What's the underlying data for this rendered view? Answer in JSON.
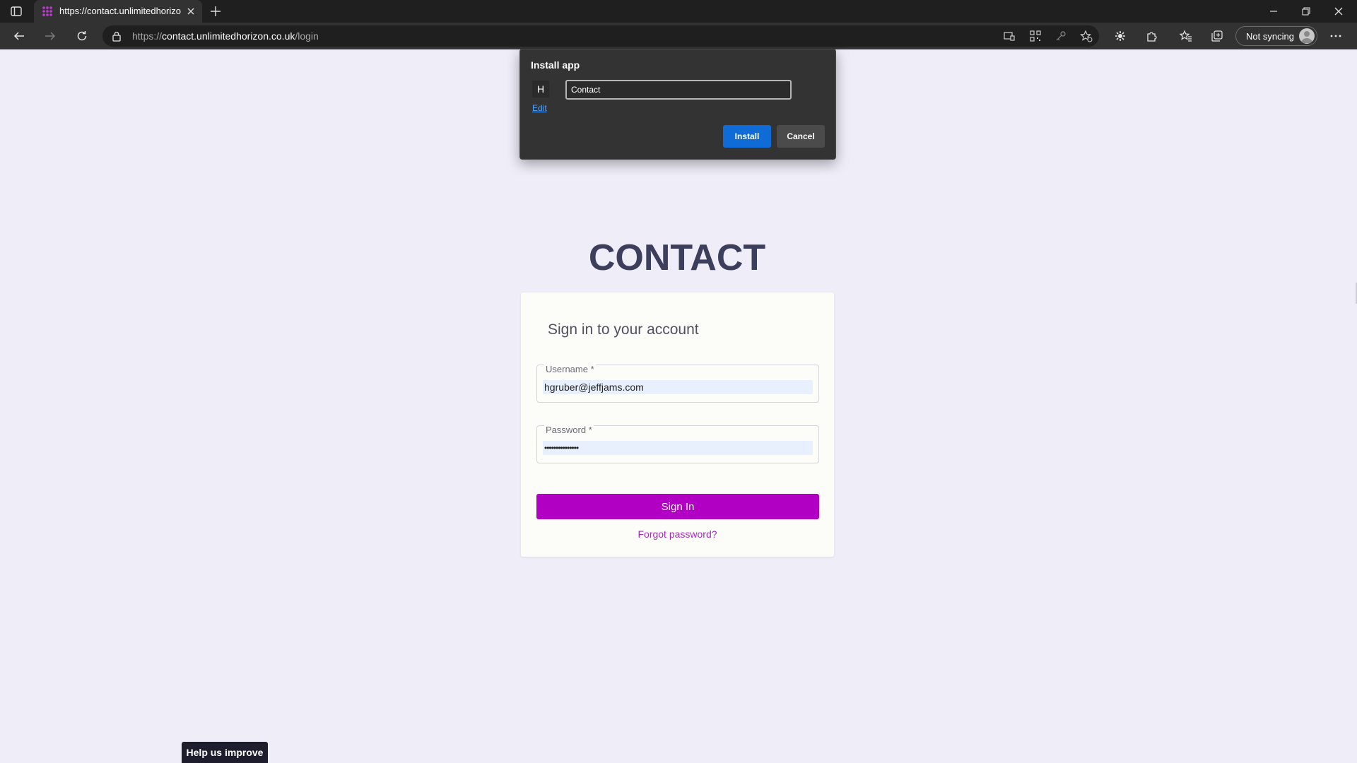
{
  "browser": {
    "tab": {
      "title": "https://contact.unlimitedhorizon.co.uk/login",
      "favicon": "app-grid-icon"
    },
    "address": {
      "scheme": "https://",
      "host": "contact.unlimitedhorizon.co.uk",
      "path": "/login"
    },
    "profile": {
      "sync_label": "Not syncing"
    }
  },
  "install_popup": {
    "title": "Install app",
    "app_icon_letter": "H",
    "edit_label": "Edit",
    "app_name_value": "Contact",
    "install_label": "Install",
    "cancel_label": "Cancel"
  },
  "page": {
    "brand": "CONTACT",
    "card_heading": "Sign in to your account",
    "username": {
      "label": "Username  *",
      "value": "hgruber@jeffjams.com"
    },
    "password": {
      "label": "Password  *",
      "value": "•••••••••••••••"
    },
    "signin_label": "Sign In",
    "forgot_label": "Forgot password?"
  },
  "feedback": {
    "label": "Help us improve"
  },
  "colors": {
    "accent": "#b100c4",
    "link": "#a22bb8",
    "install_button": "#0f6cd6",
    "background": "#efedf8"
  }
}
